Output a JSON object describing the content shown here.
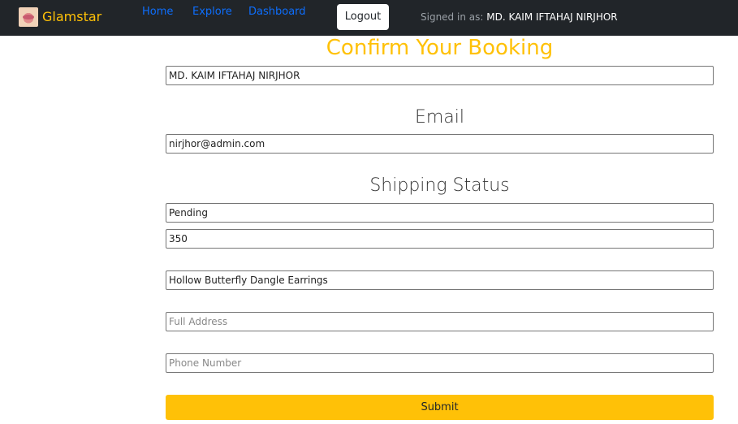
{
  "navbar": {
    "brand": "Glamstar",
    "links": [
      "Home",
      "Explore",
      "Dashboard"
    ],
    "logout_label": "Logout",
    "signed_in_prefix": "Signed in as:",
    "user_name": "MD. KAIM IFTAHAJ NIRJHOR"
  },
  "form": {
    "title": "Confirm Your Booking",
    "name_value": "MD. KAIM IFTAHAJ NIRJHOR",
    "email_heading": "Email",
    "email_value": "nirjhor@admin.com",
    "shipping_heading": "Shipping Status",
    "status_value": "Pending",
    "price_value": "350",
    "product_value": "Hollow Butterfly Dangle Earrings",
    "address_placeholder": "Full Address",
    "phone_placeholder": "Phone Number",
    "submit_label": "Submit"
  },
  "colors": {
    "navbar_bg": "#212529",
    "accent": "#ffc107",
    "link": "#0d6efd"
  }
}
